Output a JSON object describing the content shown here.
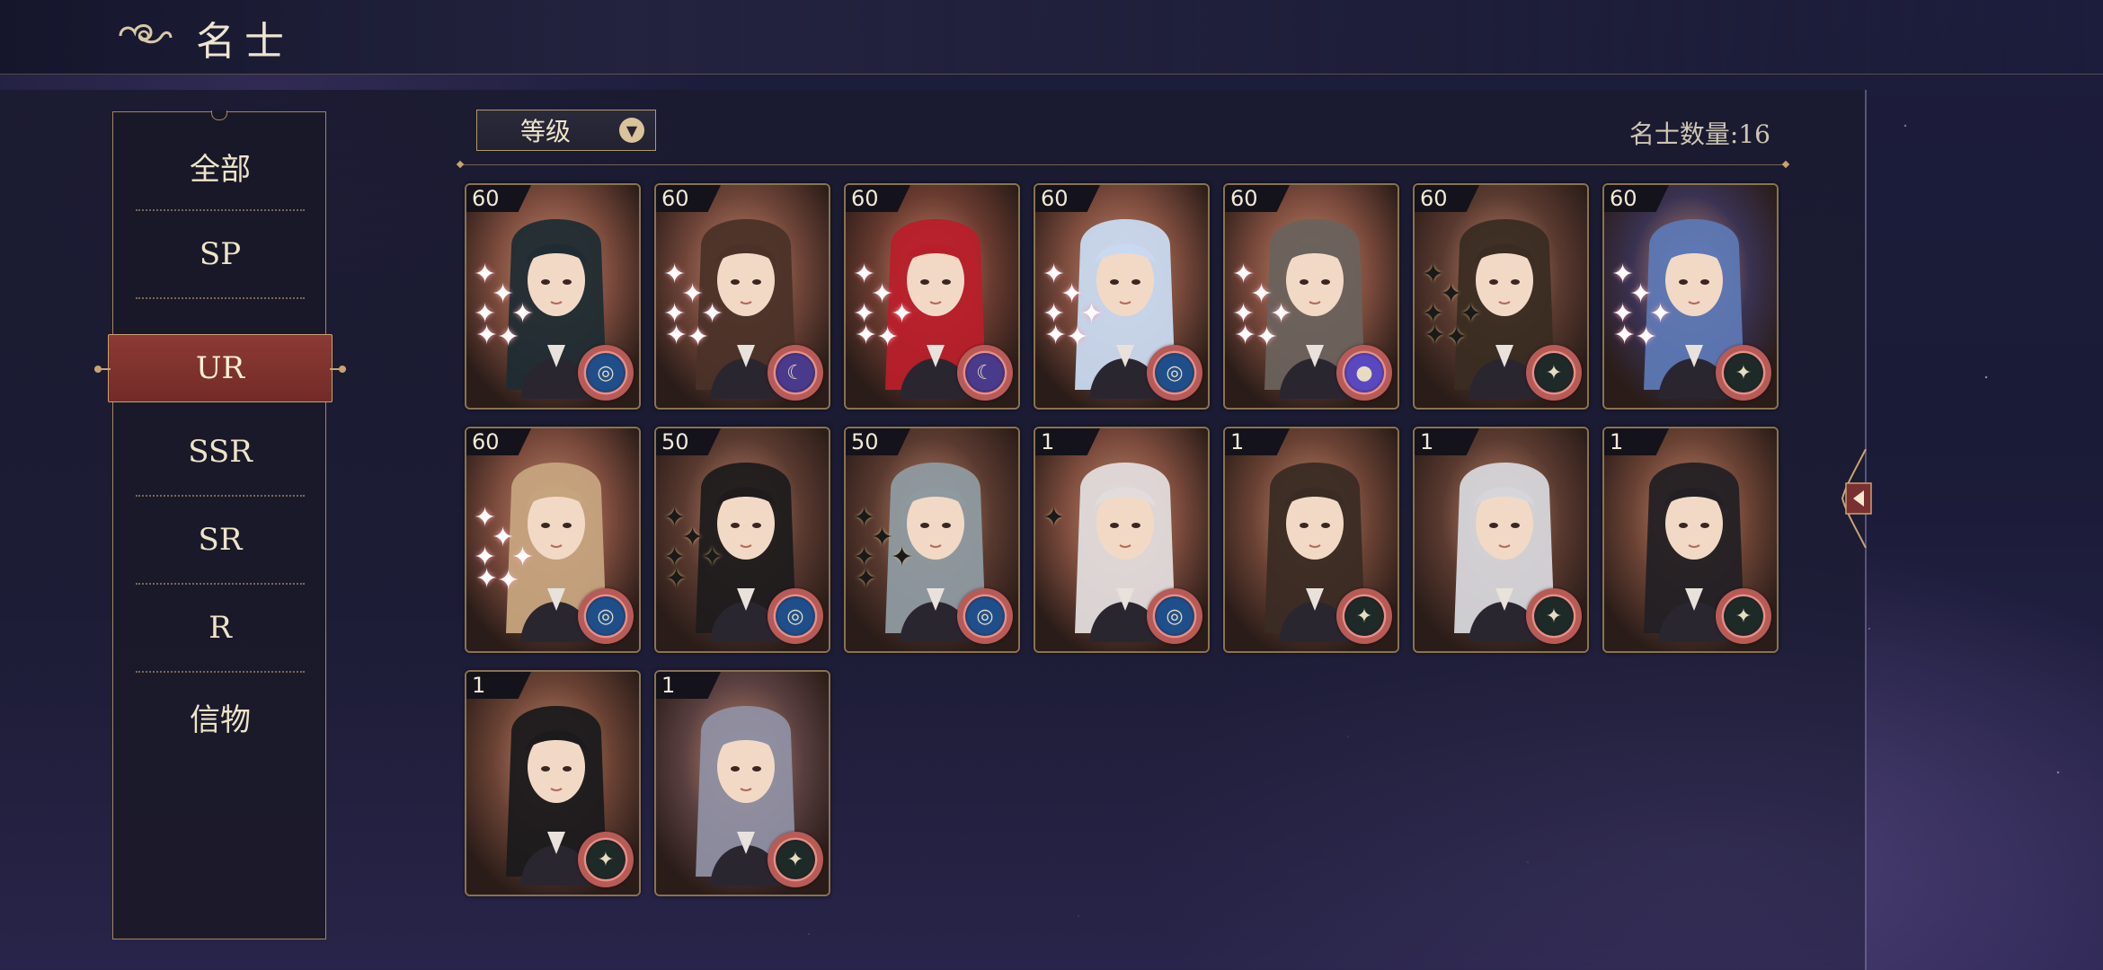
{
  "header": {
    "title": "名士"
  },
  "categories": [
    {
      "label": "全部",
      "active": false
    },
    {
      "label": "SP",
      "active": false
    },
    {
      "label": "UR",
      "active": true
    },
    {
      "label": "SSR",
      "active": false
    },
    {
      "label": "SR",
      "active": false
    },
    {
      "label": "R",
      "active": false
    },
    {
      "label": "信物",
      "active": false
    }
  ],
  "filter": {
    "label": "等级",
    "icon": "chevron-down-icon"
  },
  "count": {
    "label": "名士数量:",
    "value": "16"
  },
  "cards": [
    {
      "level": "60",
      "stars": 6,
      "star_style": "bright",
      "emblem": "sea-emblem-icon",
      "hair": "#1f2c33",
      "bg": "#7a4a3c"
    },
    {
      "level": "60",
      "stars": 6,
      "star_style": "bright",
      "emblem": "moon-orbit-icon",
      "hair": "#4b3128",
      "bg": "#6e4438"
    },
    {
      "level": "60",
      "stars": 6,
      "star_style": "bright",
      "emblem": "moon-orbit-icon",
      "hair": "#b81f2a",
      "bg": "#6a3b30"
    },
    {
      "level": "60",
      "stars": 6,
      "star_style": "bright",
      "emblem": "sea-emblem-icon",
      "hair": "#c9d9ef",
      "bg": "#7a4a3c"
    },
    {
      "level": "60",
      "stars": 6,
      "star_style": "bright",
      "emblem": "planet-orb-icon",
      "hair": "#6a625c",
      "bg": "#7a4a3c"
    },
    {
      "level": "60",
      "stars": 6,
      "star_style": "dark",
      "emblem": "compass-icon",
      "hair": "#3a2c22",
      "bg": "#5a3a30"
    },
    {
      "level": "60",
      "stars": 6,
      "star_style": "bright",
      "emblem": "compass-icon",
      "hair": "#5d78b4",
      "bg": "#3a3252"
    },
    {
      "level": "60",
      "stars": 6,
      "star_style": "bright",
      "emblem": "sea-emblem-icon",
      "hair": "#c6a47e",
      "bg": "#7a4a3c"
    },
    {
      "level": "50",
      "stars": 5,
      "star_style": "dark",
      "emblem": "sea-emblem-icon",
      "hair": "#1f1b1c",
      "bg": "#5a3a30"
    },
    {
      "level": "50",
      "stars": 5,
      "star_style": "dark",
      "emblem": "sea-emblem-icon",
      "hair": "#8e9aa0",
      "bg": "#5a3a30"
    },
    {
      "level": "1",
      "stars": 1,
      "star_style": "dark",
      "emblem": "sea-emblem-icon",
      "hair": "#e2dcdc",
      "bg": "#7a4a3c"
    },
    {
      "level": "1",
      "stars": 0,
      "star_style": "dark",
      "emblem": "compass-icon",
      "hair": "#3a2b24",
      "bg": "#6a4234"
    },
    {
      "level": "1",
      "stars": 0,
      "star_style": "dark",
      "emblem": "compass-icon",
      "hair": "#d6d6da",
      "bg": "#5a3a30"
    },
    {
      "level": "1",
      "stars": 0,
      "star_style": "dark",
      "emblem": "compass-icon",
      "hair": "#232024",
      "bg": "#6a4234"
    },
    {
      "level": "1",
      "stars": 0,
      "star_style": "dark",
      "emblem": "compass-icon",
      "hair": "#1b1a1c",
      "bg": "#6a4234"
    },
    {
      "level": "1",
      "stars": 0,
      "star_style": "dark",
      "emblem": "compass-icon",
      "hair": "#8f8fa2",
      "bg": "#5a4040"
    }
  ],
  "side_panel_toggle": {
    "icon": "chevron-left-icon"
  },
  "colors": {
    "accent": "#c9a371",
    "active_tab": "#8c3a34",
    "text": "#efe4c8"
  }
}
